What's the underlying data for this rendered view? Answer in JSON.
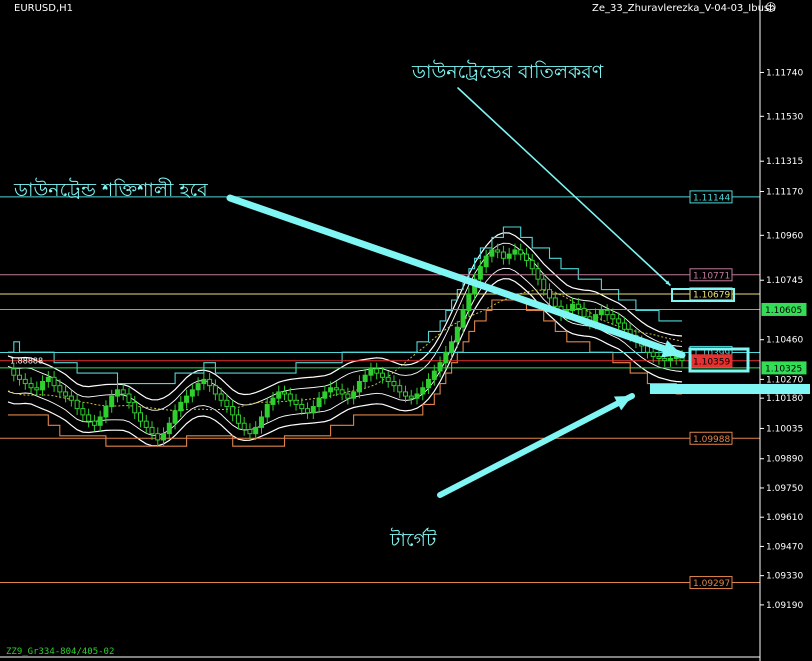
{
  "header": {
    "symbol": "EURUSD,H1",
    "indicator": "Ze_33_Zhuravlerezka_V-04-03_Ibush"
  },
  "annotations": {
    "cancel_downtrend": "ডাউনট্রেন্ডের বাতিলকরণ",
    "downtrend_strong": "ডাউনট্রেন্ড শক্তিশালী হবে",
    "target": "টার্গেট"
  },
  "footer": {
    "label": "ZZ9_Gr334-804/405-02"
  },
  "colors": {
    "background": "#000000",
    "candle": "#2fcf2f",
    "annotation": "#7ff6f4",
    "level_cyan": "#4fd6d6",
    "level_pink": "#c07a9a",
    "level_yellow": "#e8e070",
    "level_green": "#33dd55",
    "level_orange": "#e0844a",
    "level_red": "#e83030"
  },
  "chart_data": {
    "type": "candlestick",
    "ylim": [
      1.0895,
      1.1202
    ],
    "y_ticks": [
      "1.11740",
      "1.11530",
      "1.11315",
      "1.11170",
      "1.10960",
      "1.10745",
      "1.10460",
      "1.10270",
      "1.10180",
      "1.10035",
      "1.09890",
      "1.09750",
      "1.09610",
      "1.09470",
      "1.09330",
      "1.09190"
    ],
    "levels": [
      {
        "value": 1.11144,
        "label": "1.11144",
        "color": "cyan",
        "labeled": true
      },
      {
        "value": 1.10771,
        "label": "1.10771",
        "color": "pink",
        "labeled": true
      },
      {
        "value": 1.10679,
        "label": "1.10679",
        "color": "yellow",
        "labeled": true
      },
      {
        "value": 1.10605,
        "label": "1.10605",
        "color": "green",
        "labeled": true
      },
      {
        "value": 1.10399,
        "label": "1.10399",
        "color": "cyan",
        "labeled": true
      },
      {
        "value": 1.10359,
        "label": "1.10359",
        "color": "red",
        "labeled": true
      },
      {
        "value": 1.10325,
        "label": "1.10325",
        "color": "green",
        "labeled": true
      },
      {
        "value": 1.09988,
        "label": "1.09988",
        "color": "orange",
        "labeled": true
      },
      {
        "value": 1.09297,
        "label": "1.09297",
        "color": "orange",
        "labeled": true
      }
    ],
    "left_label": "1.88888",
    "current_price": 1.10359,
    "price_series_h1": [
      1.1032,
      1.1029,
      1.1027,
      1.1025,
      1.1023,
      1.1022,
      1.1026,
      1.1028,
      1.1024,
      1.1021,
      1.1019,
      1.1017,
      1.1013,
      1.101,
      1.1007,
      1.1005,
      1.1009,
      1.1014,
      1.1019,
      1.1022,
      1.102,
      1.1016,
      1.1011,
      1.1007,
      1.1004,
      1.1001,
      1.0998,
      1.1001,
      1.1006,
      1.1012,
      1.1016,
      1.1019,
      1.1022,
      1.1025,
      1.1027,
      1.1024,
      1.102,
      1.1017,
      1.1014,
      1.101,
      1.1006,
      1.1003,
      1.1001,
      1.1004,
      1.1009,
      1.1015,
      1.1018,
      1.1021,
      1.102,
      1.1017,
      1.1015,
      1.1013,
      1.1011,
      1.1014,
      1.1018,
      1.1021,
      1.1023,
      1.1022,
      1.102,
      1.1018,
      1.1021,
      1.1026,
      1.1029,
      1.1032,
      1.103,
      1.1028,
      1.1026,
      1.1024,
      1.1021,
      1.1019,
      1.1018,
      1.102,
      1.1023,
      1.1027,
      1.1031,
      1.1035,
      1.104,
      1.1045,
      1.1052,
      1.106,
      1.1068,
      1.1075,
      1.1081,
      1.1086,
      1.1089,
      1.1088,
      1.1085,
      1.1087,
      1.1089,
      1.1087,
      1.1084,
      1.108,
      1.1075,
      1.107,
      1.1066,
      1.1062,
      1.1058,
      1.106,
      1.1063,
      1.1061,
      1.1057,
      1.1054,
      1.1058,
      1.106,
      1.1058,
      1.1056,
      1.1054,
      1.1051,
      1.1048,
      1.1045,
      1.1043,
      1.104,
      1.1038,
      1.1037,
      1.1036,
      1.1037,
      1.1038,
      1.1036
    ]
  }
}
